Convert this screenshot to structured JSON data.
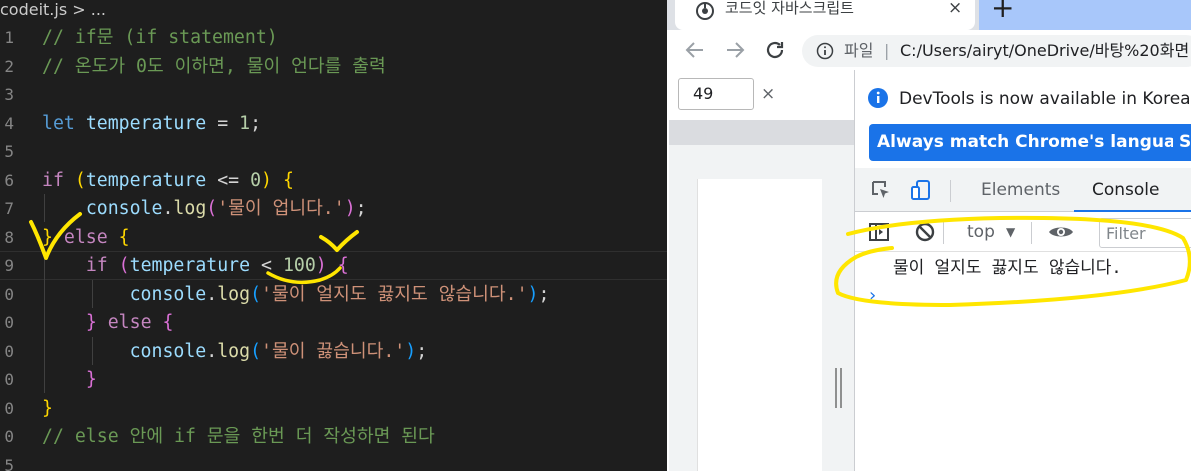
{
  "editor": {
    "breadcrumb": "codeit.js > ...",
    "line_numbers": [
      "1",
      "2",
      "3",
      "4",
      "5",
      "6",
      "7",
      "8",
      "9",
      "0",
      "0",
      "0",
      "0",
      "0",
      "0",
      "5"
    ],
    "lines": {
      "l1": "// if문 (if statement)",
      "l2": "// 온도가 0도 이하면, 물이 언다를 출력",
      "l4_kw": "let",
      "l4_var": "temperature",
      "l4_op": " = ",
      "l4_num": "1",
      "l4_end": ";",
      "l6_kw": "if",
      "l6_var": "temperature",
      "l6_op": " <= ",
      "l6_num": "0",
      "l7_obj": "console",
      "l7_fn": "log",
      "l7_str": "'물이 업니다.'",
      "l8_kw": "else",
      "l9_kw": "if",
      "l9_var": "temperature",
      "l9_op": " < ",
      "l9_num": "100",
      "l10_obj": "console",
      "l10_fn": "log",
      "l10_str": "'물이 얼지도 끓지도 않습니다.'",
      "l11_kw": "else",
      "l12_obj": "console",
      "l12_fn": "log",
      "l12_str": "'물이 끓습니다.'",
      "l15_cmt_a": "// else ",
      "l15_cmt_b": "안에 ",
      "l15_cmt_c": "if ",
      "l15_cmt_d": "문을 한번 더 작성하면 된다"
    }
  },
  "browser": {
    "tab_title": "코드잇 자바스크립트",
    "tab_close": "×",
    "new_tab": "+",
    "omnibox": {
      "scheme_label": "파일",
      "separator": "|",
      "url": "C:/Users/airyt/OneDrive/바탕%20화면"
    },
    "device_toolbar": {
      "width_value": "49",
      "times": "×"
    },
    "devtools": {
      "info_text": "DevTools is now available in Korean",
      "btn_match_language": "Always match Chrome's language",
      "btn_switch": "S",
      "tab_elements": "Elements",
      "tab_console": "Console",
      "context": "top",
      "filter_placeholder": "Filter",
      "console_output": "물이 얼지도 끓지도 않습니다.",
      "prompt": "›"
    }
  },
  "colors": {
    "editor_bg": "#1e1e1e",
    "annotation": "#ffe600",
    "accent_blue": "#1a73e8"
  },
  "icons": [
    "chrome-favicon",
    "back-arrow-icon",
    "forward-arrow-icon",
    "reload-icon",
    "info-circle-icon",
    "inspect-element-icon",
    "device-toggle-icon",
    "sidebar-toggle-icon",
    "clear-console-icon",
    "eye-icon",
    "close-icon",
    "plus-icon"
  ]
}
